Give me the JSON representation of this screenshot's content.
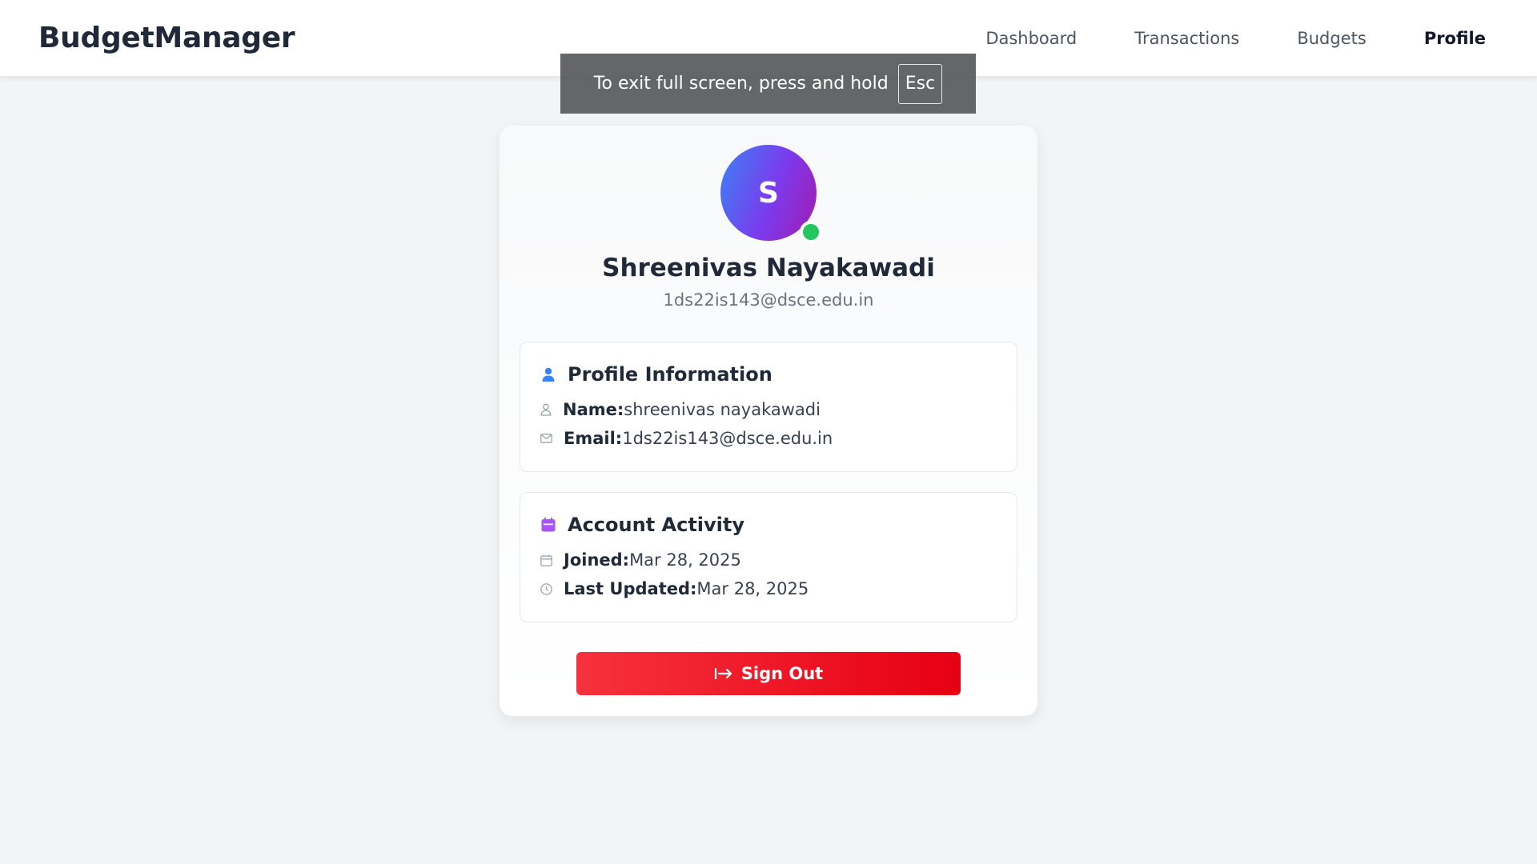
{
  "app": {
    "brand": "BudgetManager"
  },
  "nav": {
    "items": [
      {
        "label": "Dashboard"
      },
      {
        "label": "Transactions"
      },
      {
        "label": "Budgets"
      },
      {
        "label": "Profile",
        "active": true
      }
    ]
  },
  "fullscreen_toast": {
    "message": "To exit full screen, press and hold",
    "key": "Esc"
  },
  "profile": {
    "avatar_initial": "S",
    "display_name": "Shreenivas Nayakawadi",
    "email": "1ds22is143@dsce.edu.in",
    "status_color": "#22c55e"
  },
  "profile_info": {
    "title": "Profile Information",
    "name_label": "Name:",
    "name_value": "shreenivas nayakawadi",
    "email_label": "Email:",
    "email_value": "1ds22is143@dsce.edu.in"
  },
  "account_activity": {
    "title": "Account Activity",
    "joined_label": "Joined:",
    "joined_value": "Mar 28, 2025",
    "updated_label": "Last Updated:",
    "updated_value": "Mar 28, 2025"
  },
  "actions": {
    "signout_label": "Sign Out"
  },
  "colors": {
    "accent_blue": "#3b82f6",
    "accent_purple": "#a855f7",
    "danger": "#e60012"
  }
}
